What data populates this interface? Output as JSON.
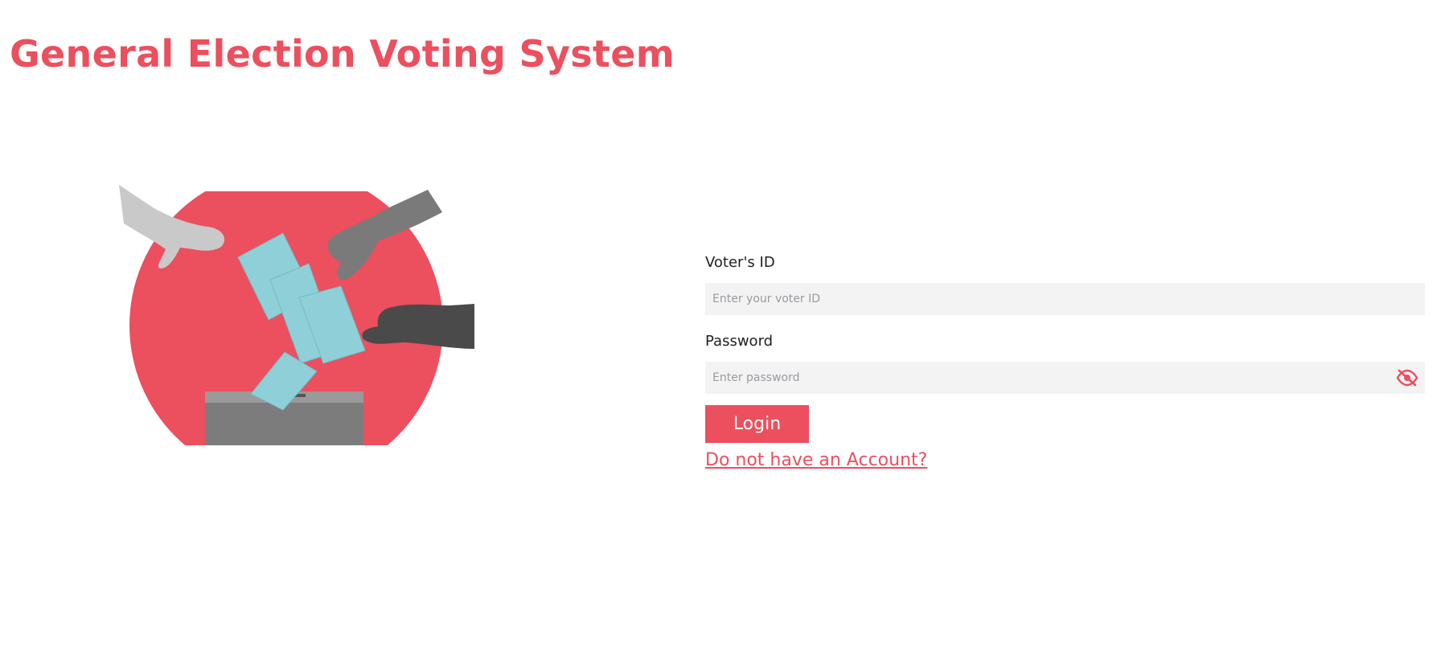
{
  "header": {
    "title": "General Election Voting System"
  },
  "illustration": {
    "name": "ballot-box-illustration",
    "accent_color": "#ec4f5e",
    "ballot_color": "#8fd0d8"
  },
  "login_form": {
    "voter_id": {
      "label": "Voter's ID",
      "placeholder": "Enter your voter ID",
      "value": ""
    },
    "password": {
      "label": "Password",
      "placeholder": "Enter password",
      "value": "",
      "toggle_icon": "eye-slash-icon"
    },
    "login_label": "Login",
    "register_link": "Do not have an Account?"
  },
  "colors": {
    "brand": "#ec4f5e",
    "input_bg": "#f3f3f3"
  }
}
